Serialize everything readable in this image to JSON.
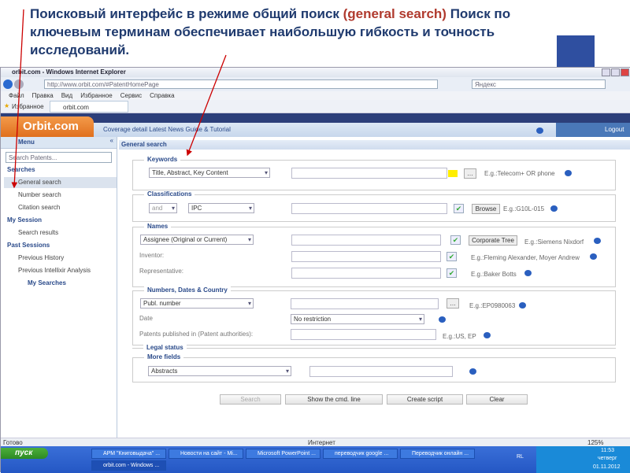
{
  "caption": {
    "before": "Поисковый интерфейс в режиме общий поиск ",
    "highlight": "(general search)",
    "after": " Поиск по ключевым терминам обеспечивает наибольшую гибкость и точность исследований."
  },
  "browser": {
    "title": "orbit.com - Windows Internet Explorer",
    "url": "http://www.orbit.com/#PatentHomePage",
    "search_placeholder": "Яндекс",
    "menu": [
      "Файл",
      "Правка",
      "Вид",
      "Избранное",
      "Сервис",
      "Справка"
    ],
    "favorites": "Избранное",
    "tab": "orbit.com",
    "status": "Готово",
    "zone": "Интернет",
    "zoom": "125%"
  },
  "app": {
    "logo": "Orbit.com",
    "nav": [
      "Coverage detail",
      "Latest News",
      "Guide & Tutorial"
    ],
    "logout": "Logout"
  },
  "sidebar": {
    "menu_tab": "Menu",
    "search_placeholder": "Search Patents...",
    "groups": [
      {
        "label": "Searches",
        "items": [
          "General search",
          "Number search",
          "Citation search"
        ]
      },
      {
        "label": "My Session",
        "items": [
          "Search results"
        ]
      },
      {
        "label": "Past Sessions",
        "items": [
          "Previous History",
          "Previous Intellixir Analysis"
        ]
      },
      {
        "label": "My Searches",
        "items": []
      }
    ],
    "selected": "General search"
  },
  "main": {
    "title": "General search",
    "keywords": {
      "legend": "Keywords",
      "field": "Title, Abstract, Key Content",
      "example": "E.g.:Telecom+ OR phone"
    },
    "classifications": {
      "legend": "Classifications",
      "operator": "and",
      "field": "IPC",
      "browse": "Browse",
      "example": "E.g.:G10L-015"
    },
    "names": {
      "legend": "Names",
      "field": "Assignee (Original or Current)",
      "corporate_tree": "Corporate Tree",
      "example": "E.g.:Siemens Nixdorf",
      "inventor_label": "Inventor:",
      "inventor_example": "E.g.:Fleming Alexander, Moyer Andrew",
      "rep_label": "Representative:",
      "rep_example": "E.g.:Baker Botts"
    },
    "numbers": {
      "legend": "Numbers, Dates & Country",
      "field": "Publ. number",
      "example": "E.g.:EP0980063",
      "date_label": "Date",
      "date_value": "No restriction",
      "auth_label": "Patents published in (Patent authorities):",
      "auth_example": "E.g.:US, EP"
    },
    "legal_status": "Legal status",
    "more_fields": {
      "legend": "More fields",
      "field": "Abstracts"
    },
    "buttons": {
      "search": "Search",
      "cmd": "Show the cmd. line",
      "script": "Create script",
      "clear": "Clear"
    }
  },
  "taskbar": {
    "start": "пуск",
    "items": [
      "АРМ \"Книговыдача\" ...",
      "Новости на сайт - Mi...",
      "Microsoft PowerPoint ...",
      "переводчик google ...",
      "Переводчик онлайн ...",
      "orbit.com - Windows ..."
    ],
    "lang": "RL",
    "time": "11:53",
    "day": "четверг",
    "date": "01.11.2012"
  },
  "colors": {
    "accent": "#e0701e",
    "nav_blue": "#2c3f7a",
    "annotation": "#cc0000"
  }
}
